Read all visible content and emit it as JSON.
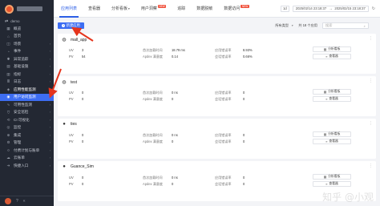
{
  "sidebar": {
    "workspace": "demo",
    "items": [
      {
        "label": "概览",
        "icon": "grid-icon",
        "glyph": "▦",
        "chevron": false
      },
      {
        "label": "首页",
        "icon": "home-icon",
        "glyph": "⌂",
        "chevron": false
      },
      {
        "label": "场景",
        "icon": "scene-icon",
        "glyph": "◫",
        "chevron": true
      },
      {
        "label": "事件",
        "icon": "bell-icon",
        "glyph": "◔",
        "chevron": true
      },
      {
        "label": "异常追踪",
        "icon": "bug-icon",
        "glyph": "✱",
        "chevron": true
      },
      {
        "label": "基础设施",
        "icon": "server-icon",
        "glyph": "▤",
        "chevron": true
      },
      {
        "label": "指标",
        "icon": "chart-icon",
        "glyph": "▥",
        "chevron": true
      },
      {
        "label": "日志",
        "icon": "log-icon",
        "glyph": "≣",
        "chevron": true
      },
      {
        "label": "应用性能监测",
        "icon": "apm-icon",
        "glyph": "◈",
        "chevron": true
      },
      {
        "label": "用户访问监测",
        "icon": "rum-icon",
        "glyph": "◉",
        "chevron": true
      },
      {
        "label": "可用性监测",
        "icon": "pulse-icon",
        "glyph": "∿",
        "chevron": true
      },
      {
        "label": "安全巡检",
        "icon": "shield-icon",
        "glyph": "⛉",
        "chevron": true
      },
      {
        "label": "CI 可视化",
        "icon": "ci-icon",
        "glyph": "⟲",
        "chevron": true
      },
      {
        "label": "监控",
        "icon": "monitor-icon",
        "glyph": "◎",
        "chevron": true
      },
      {
        "label": "集成",
        "icon": "plug-icon",
        "glyph": "⊕",
        "chevron": true
      },
      {
        "label": "管理",
        "icon": "gear-icon",
        "glyph": "⚙",
        "chevron": true
      },
      {
        "label": "付费计划与账单",
        "icon": "billing-icon",
        "glyph": "¤",
        "chevron": true
      },
      {
        "label": "云账单",
        "icon": "cloud-icon",
        "glyph": "☁",
        "chevron": true
      },
      {
        "label": "快捷入口",
        "icon": "shortcut-icon",
        "glyph": "➔",
        "chevron": true
      }
    ]
  },
  "topbar": {
    "tabs": [
      {
        "label": "应用列表",
        "active": true
      },
      {
        "label": "查看器",
        "active": false
      },
      {
        "label": "分析看板",
        "active": false,
        "dropdown": true
      },
      {
        "label": "用户洞察",
        "active": false,
        "badge": "NEW"
      },
      {
        "label": "追踪",
        "active": false
      },
      {
        "label": "数据脱敏",
        "active": false
      },
      {
        "label": "数据访问",
        "active": false,
        "badge": "NEW"
      }
    ],
    "time_shortcut": "1d",
    "time_start": "2025/02/14 23:18:37",
    "time_sep": "→",
    "time_end": "2025/02/15 23:18:37"
  },
  "toolbar": {
    "new_app_label": "新建应用",
    "type_filter": "所有类型",
    "count_text": "共 18 个应用",
    "search_placeholder": "搜索"
  },
  "labels": {
    "uv": "UV",
    "pv": "PV",
    "avg_load": "首次加载时间",
    "apdex": "Apdex 满意度",
    "error_rate": "应用错误率",
    "session_error": "会话错误率",
    "analyze": "分析看板",
    "viewer": "查看器"
  },
  "apps": [
    {
      "name": "mall_app",
      "os": "android",
      "os_glyph": "◍",
      "uv": "3",
      "pv": "54",
      "avg_load": "18.79 ms",
      "apdex": "0.14",
      "error_rate": "8.93%",
      "session_error": "0.66%"
    },
    {
      "name": "test",
      "os": "android",
      "os_glyph": "◍",
      "uv": "0",
      "pv": "0",
      "avg_load": "0 ns",
      "apdex": "0",
      "error_rate": "0",
      "session_error": "0"
    },
    {
      "name": "ties",
      "os": "apple",
      "os_glyph": "●",
      "uv": "0",
      "pv": "0",
      "avg_load": "0 ns",
      "apdex": "0",
      "error_rate": "0",
      "session_error": "0"
    },
    {
      "name": "Guance_Sim",
      "os": "apple",
      "os_glyph": "●",
      "uv": "0",
      "pv": "0",
      "avg_load": "0 ns",
      "apdex": "0",
      "error_rate": "0",
      "session_error": "0"
    }
  ],
  "watermark": "知乎 @小观",
  "accent_color": "#3d6df2",
  "annotation_color": "#e5341c"
}
